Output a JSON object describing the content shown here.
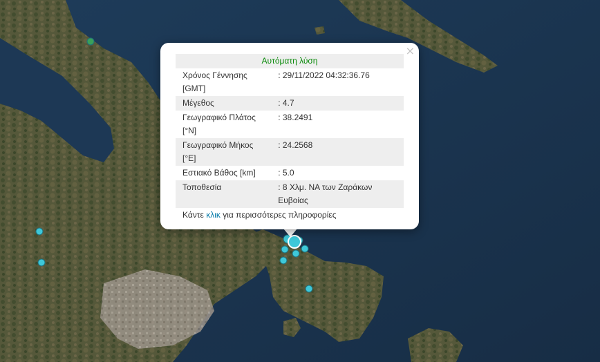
{
  "popup": {
    "close_symbol": "×",
    "header": "Αυτόματη λύση",
    "rows": [
      {
        "label": "Χρόνος Γέννησης [GMT]",
        "value": ": 29/11/2022 04:32:36.76"
      },
      {
        "label": "Μέγεθος",
        "value": ": 4.7"
      },
      {
        "label": "Γεωγραφικό Πλάτος [°N]",
        "value": ": 38.2491"
      },
      {
        "label": "Γεωγραφικό Μήκος [°E]",
        "value": ": 24.2568"
      },
      {
        "label": "Εστιακό Βάθος [km]",
        "value": ": 5.0"
      },
      {
        "label": "Τοποθεσία",
        "value": ": 8 Χλμ. ΝΑ των Ζαράκων Ευβοίας"
      }
    ],
    "more_prefix": "Κάντε ",
    "more_link": "κλικ",
    "more_suffix": " για περισσότερες πληροφορίες"
  },
  "colors": {
    "header_text": "#0a8a0a",
    "link": "#0078a8",
    "marker_cyan": "#3ec8d9",
    "marker_green": "#3aa05a",
    "sea": "#1b3550",
    "land": "#5a5a3a"
  },
  "icons": {
    "close": "close-icon",
    "markers": "earthquake-marker-icon"
  }
}
